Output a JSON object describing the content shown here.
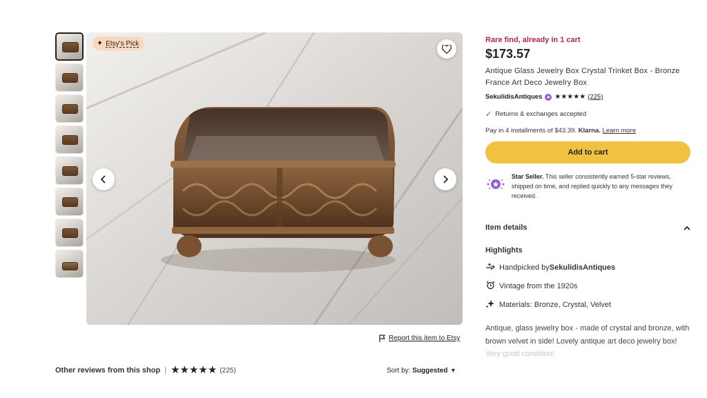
{
  "badge": {
    "label": "Etsy's Pick"
  },
  "thumbnails": [
    {
      "name": "thumb-1"
    },
    {
      "name": "thumb-2"
    },
    {
      "name": "thumb-3"
    },
    {
      "name": "thumb-4"
    },
    {
      "name": "thumb-5"
    },
    {
      "name": "thumb-6"
    },
    {
      "name": "thumb-7"
    },
    {
      "name": "thumb-8"
    }
  ],
  "icons": {
    "favorite": "heart-icon",
    "prev": "chevron-left-icon",
    "next": "chevron-right-icon",
    "flag": "flag-icon",
    "sparkle": "sparkle-icon",
    "check": "check-icon",
    "star_seller": "star-seller-icon"
  },
  "report": {
    "label": "Report this item to Etsy"
  },
  "reviews": {
    "title": "Other reviews from this shop",
    "separator": "|",
    "stars": "★★★★★",
    "count": "(225)"
  },
  "sort": {
    "label": "Sort by:",
    "value": "Suggested"
  },
  "product": {
    "rare": "Rare find, already in 1 cart",
    "price": "$173.57",
    "title": "Antique Glass Jewelry Box Crystal Trinket Box - Bronze France Art Deco Jewelry Box",
    "shop": "SekulidisAntiques",
    "stars": "★★★★★",
    "review_count": "(225)",
    "returns": "Returns & exchanges accepted",
    "install_prefix": "Pay in 4 installments of $43.39.",
    "install_brand": "Klarna.",
    "install_link": "Learn more",
    "add_to_cart": "Add to cart",
    "star_seller_title": "Star Seller.",
    "star_seller_text": " This seller consistently earned 5-star reviews, shipped on time, and replied quickly to any messages they received."
  },
  "details": {
    "title": "Item details",
    "highlights_title": "Highlights",
    "highlights": [
      {
        "prefix": "Handpicked by ",
        "bold": "SekulidisAntiques"
      },
      {
        "prefix": "Vintage from the 1920s",
        "bold": ""
      },
      {
        "prefix": "Materials: Bronze, Crystal, Velvet",
        "bold": ""
      }
    ],
    "description": "Antique, glass jewelry box - made of crystal and bronze, with brown velvet in side! Lovely antique art deco jewelry box!",
    "description_faded": "Very good condition!"
  },
  "colors": {
    "accent": "#f1c141",
    "rare": "#b12457",
    "badge": "#fbd8bd",
    "seller": "#9560d2"
  }
}
